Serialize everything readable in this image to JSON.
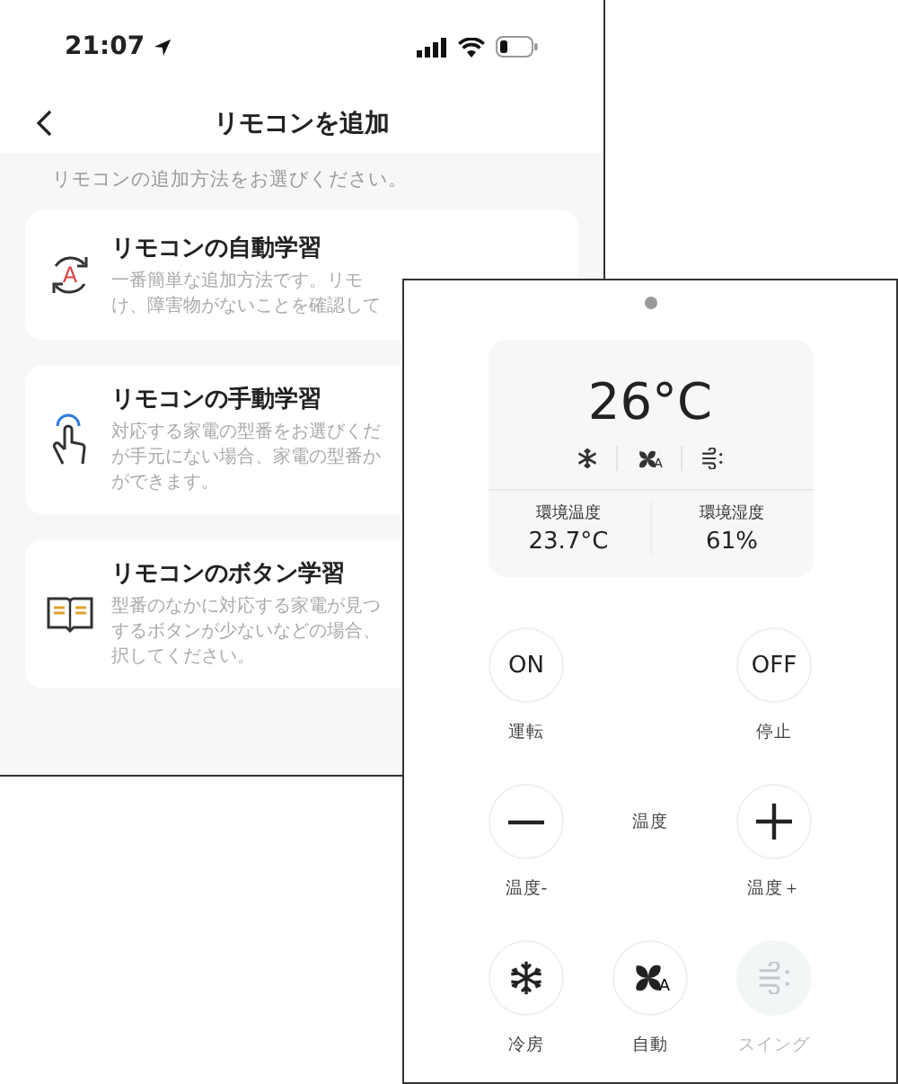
{
  "status_bar": {
    "time": "21:07"
  },
  "header": {
    "title": "リモコンを追加"
  },
  "instruction": "リモコンの追加方法をお選びください。",
  "methods": [
    {
      "kind": "auto",
      "badge": "A",
      "title": "リモコンの自動学習",
      "description_lines": [
        "一番簡単な追加方法です。リモ",
        "け、障害物がないことを確認して"
      ]
    },
    {
      "kind": "manual",
      "title": "リモコンの手動学習",
      "description_lines": [
        "対応する家電の型番をお選びくだ",
        "が手元にない場合、家電の型番か",
        "ができます。"
      ]
    },
    {
      "kind": "button",
      "title": "リモコンのボタン学習",
      "description_lines": [
        "型番のなかに対応する家電が見つ",
        "するボタンが少ないなどの場合、",
        "択してください。"
      ]
    }
  ],
  "remote": {
    "setpoint": "26°C",
    "indicators": [
      {
        "kind": "cool"
      },
      {
        "kind": "fan",
        "badge": "A"
      },
      {
        "kind": "swing"
      }
    ],
    "readings": [
      {
        "label": "環境温度",
        "value": "23.7°C"
      },
      {
        "label": "環境湿度",
        "value": "61%"
      }
    ],
    "rows": [
      [
        {
          "kind": "text",
          "text": "ON",
          "label": "運転",
          "disabled": false
        },
        {
          "kind": "empty"
        },
        {
          "kind": "text",
          "text": "OFF",
          "label": "停止",
          "disabled": false
        }
      ],
      [
        {
          "kind": "minus",
          "label": "温度-",
          "disabled": false
        },
        {
          "kind": "caption",
          "text": "温度"
        },
        {
          "kind": "plus",
          "label": "温度＋",
          "disabled": false
        }
      ],
      [
        {
          "kind": "cool",
          "label": "冷房",
          "disabled": false
        },
        {
          "kind": "fan",
          "badge": "A",
          "label": "自動",
          "disabled": false
        },
        {
          "kind": "swing",
          "label": "スイング",
          "disabled": true
        }
      ]
    ]
  }
}
